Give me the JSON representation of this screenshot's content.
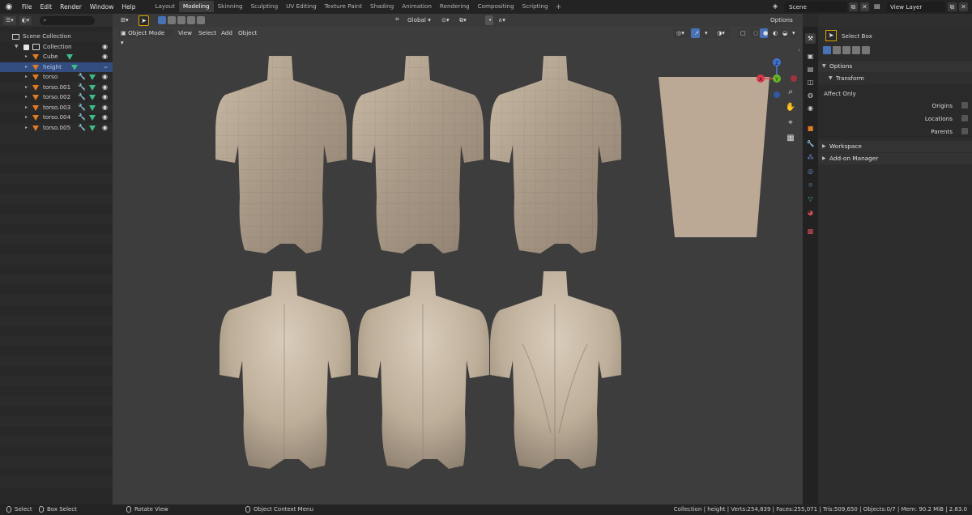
{
  "topbar": {
    "menus": [
      "File",
      "Edit",
      "Render",
      "Window",
      "Help"
    ],
    "workspace_tabs": [
      "Layout",
      "Modeling",
      "Skinning",
      "Sculpting",
      "UV Editing",
      "Texture Paint",
      "Shading",
      "Animation",
      "Rendering",
      "Compositing",
      "Scripting"
    ],
    "active_tab": "Modeling",
    "scene": "Scene",
    "view_layer": "View Layer"
  },
  "outliner": {
    "root": "Scene Collection",
    "collection": "Collection",
    "objects": [
      {
        "name": "Cube",
        "selected": false,
        "modifier": false
      },
      {
        "name": "height",
        "selected": true,
        "modifier": false
      },
      {
        "name": "torso",
        "selected": false,
        "modifier": true
      },
      {
        "name": "torso.001",
        "selected": false,
        "modifier": true
      },
      {
        "name": "torso.002",
        "selected": false,
        "modifier": true
      },
      {
        "name": "torso.003",
        "selected": false,
        "modifier": true
      },
      {
        "name": "torso.004",
        "selected": false,
        "modifier": true
      },
      {
        "name": "torso.005",
        "selected": false,
        "modifier": true
      }
    ]
  },
  "viewport": {
    "mode": "Object Mode",
    "menus": [
      "View",
      "Select",
      "Add",
      "Object"
    ],
    "orientation": "Global",
    "options_label": "Options",
    "gizmo_axes": {
      "x": "X",
      "y": "Y",
      "z": "Z"
    }
  },
  "properties": {
    "tool": "Select Box",
    "sections": {
      "options": "Options",
      "transform": "Transform",
      "affect_only": "Affect Only",
      "origins": "Origins",
      "locations": "Locations",
      "parents": "Parents",
      "workspace": "Workspace",
      "addon_manager": "Add-on Manager"
    }
  },
  "statusbar": {
    "select": "Select",
    "box_select": "Box Select",
    "rotate_view": "Rotate View",
    "context_menu": "Object Context Menu",
    "stats": "Collection | height | Verts:254,839 | Faces:255,071 | Tris:509,650 | Objects:0/7 | Mem: 90.2 MiB | 2.83.0"
  },
  "colors": {
    "accent": "#4772b3",
    "selection": "#334d80",
    "object_icon": "#e07a24",
    "mesh_icon": "#3dbb88",
    "modifier_icon": "#6b8fd8"
  }
}
